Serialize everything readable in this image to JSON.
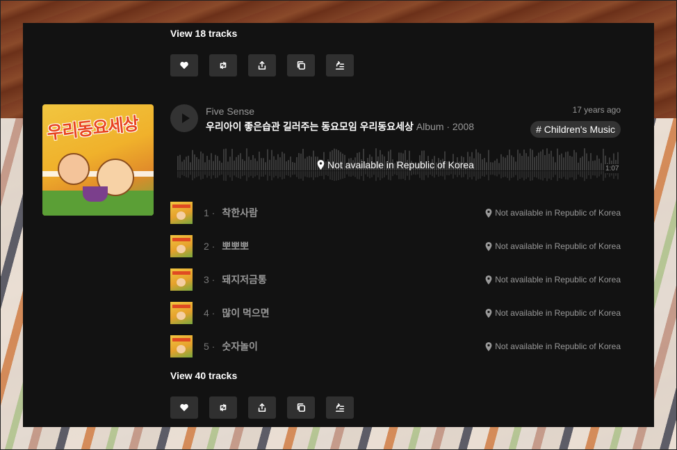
{
  "top_section": {
    "view_tracks": "View 18 tracks"
  },
  "album": {
    "artist": "Five Sense",
    "title": "우리아이 좋은습관 길러주는 동요모임 우리동요세상",
    "meta": "Album · 2008",
    "time_ago": "17 years ago",
    "genre": "# Children's Music",
    "cover_title": "우리동요세상",
    "waveform_message": "Not available in Republic of Korea",
    "duration": "1:07",
    "tracks": [
      {
        "num": "1 ·",
        "name": "착한사람",
        "status": "Not available in Republic of Korea"
      },
      {
        "num": "2 ·",
        "name": "뽀뽀뽀",
        "status": "Not available in Republic of Korea"
      },
      {
        "num": "3 ·",
        "name": "돼지저금통",
        "status": "Not available in Republic of Korea"
      },
      {
        "num": "4 ·",
        "name": "많이 먹으면",
        "status": "Not available in Republic of Korea"
      },
      {
        "num": "5 ·",
        "name": "숫자놀이",
        "status": "Not available in Republic of Korea"
      }
    ],
    "view_tracks": "View 40 tracks"
  },
  "action_icons": [
    "heart-icon",
    "repost-icon",
    "share-icon",
    "copy-link-icon",
    "add-to-next-up-icon"
  ],
  "colors": {
    "panel_bg": "#121212",
    "button_bg": "#303030",
    "muted_text": "#999999"
  }
}
